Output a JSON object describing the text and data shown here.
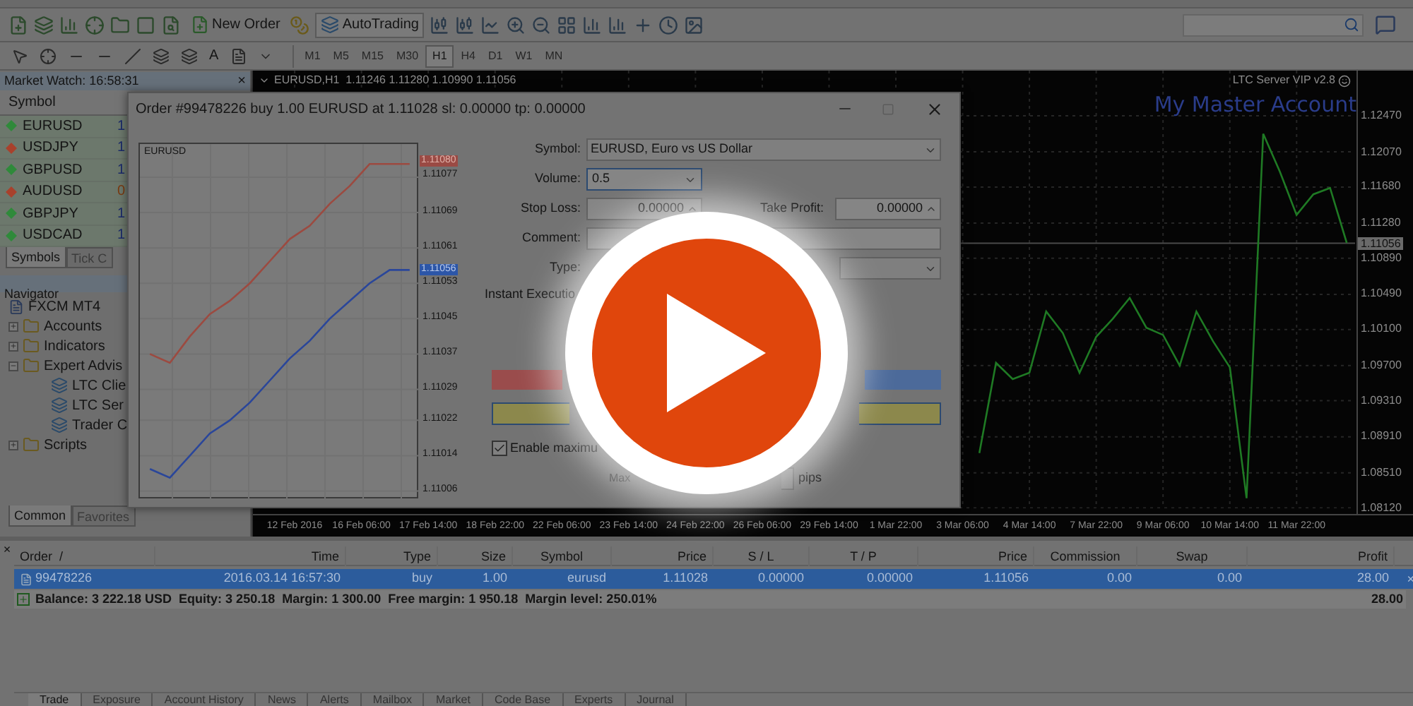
{
  "toolbar": {
    "new_order": "New Order",
    "auto_trading": "AutoTrading",
    "text_tool": "A",
    "timeframes": [
      {
        "label": "M1",
        "selected": false
      },
      {
        "label": "M5",
        "selected": false
      },
      {
        "label": "M15",
        "selected": false
      },
      {
        "label": "M30",
        "selected": false
      },
      {
        "label": "H1",
        "selected": true
      },
      {
        "label": "H4",
        "selected": false
      },
      {
        "label": "D1",
        "selected": false
      },
      {
        "label": "W1",
        "selected": false
      },
      {
        "label": "MN",
        "selected": false
      }
    ]
  },
  "market_watch": {
    "title": "Market Watch: 16:58:31",
    "close": "×",
    "column": "Symbol",
    "rows": [
      {
        "symbol": "EURUSD",
        "bid": "1",
        "color": "#2f8a3a"
      },
      {
        "symbol": "USDJPY",
        "bid": "1",
        "color": "#a8412c"
      },
      {
        "symbol": "GBPUSD",
        "bid": "1",
        "color": "#2f8a3a"
      },
      {
        "symbol": "AUDUSD",
        "bid": "0",
        "color": "#a8412c"
      },
      {
        "symbol": "GBPJPY",
        "bid": "1",
        "color": "#2f8a3a"
      },
      {
        "symbol": "USDCAD",
        "bid": "1",
        "color": "#2f8a3a"
      }
    ],
    "tabs": [
      {
        "label": "Symbols",
        "selected": true
      },
      {
        "label": "Tick C",
        "selected": false
      }
    ]
  },
  "navigator": {
    "title": "Navigator",
    "root": "FXCM MT4",
    "items": [
      {
        "label": "Accounts",
        "expanded": false
      },
      {
        "label": "Indicators",
        "expanded": false
      },
      {
        "label": "Expert Advis",
        "expanded": true,
        "children": [
          {
            "label": "LTC Clie"
          },
          {
            "label": "LTC Ser"
          },
          {
            "label": "Trader C"
          }
        ]
      },
      {
        "label": "Scripts",
        "expanded": false
      }
    ],
    "tabs": [
      {
        "label": "Common",
        "selected": true
      },
      {
        "label": "Favorites",
        "selected": false
      }
    ]
  },
  "chart": {
    "title": "EURUSD,H1  1.11246 1.11280 1.10990 1.11056",
    "server": "LTC Server VIP v2.8",
    "account": "My Master Account",
    "chart_data": {
      "type": "line",
      "categories": [
        null,
        null,
        "12 Feb 2016",
        null,
        null,
        null,
        "16 Feb 06:00",
        null,
        null,
        null,
        "17 Feb 14:00",
        null,
        null,
        null,
        "18 Feb 22:00",
        null,
        null,
        null,
        "22 Feb 06:00",
        null,
        null,
        null,
        "23 Feb 14:00",
        null,
        null,
        null,
        "24 Feb 22:00",
        null,
        null,
        null,
        "26 Feb 06:00",
        null,
        null,
        null,
        "29 Feb 14:00",
        null,
        null,
        null,
        "1 Mar 22:00",
        null,
        null,
        null,
        "3 Mar 06:00",
        null,
        null,
        null,
        "4 Mar 14:00",
        null,
        null,
        null,
        "7 Mar 22:00",
        null,
        null,
        null,
        "9 Mar 06:00",
        null,
        null,
        null,
        "10 Mar 14:00",
        null,
        null,
        null,
        "11 Mar 22:00",
        null,
        null,
        null
      ],
      "grid": true,
      "ref_lines": [
        {
          "axis": "y",
          "value": 1.11056,
          "label": "1.11056"
        }
      ],
      "series": [
        {
          "color": "#1f7a24",
          "values": [
            null,
            null,
            null,
            null,
            null,
            null,
            null,
            null,
            null,
            null,
            null,
            null,
            null,
            null,
            null,
            null,
            null,
            null,
            null,
            null,
            null,
            null,
            null,
            null,
            null,
            null,
            null,
            null,
            null,
            null,
            null,
            null,
            null,
            null,
            null,
            null,
            null,
            null,
            null,
            null,
            null,
            null,
            null,
            1.0873,
            1.0973,
            1.0955,
            1.0962,
            1.103,
            1.1006,
            1.0962,
            1.1002,
            1.1022,
            1.1045,
            1.1012,
            1.1004,
            1.097,
            1.103,
            1.0997,
            1.0968,
            1.0823,
            1.1227,
            1.1185,
            1.1137,
            1.116,
            1.1167,
            1.1106
          ]
        }
      ],
      "ylim": [
        1.08117,
        1.12971
      ],
      "yticks": [
        {
          "value": 1.1247,
          "label": "1.12470"
        },
        {
          "value": 1.1207,
          "label": "1.12070"
        },
        {
          "value": 1.1168,
          "label": "1.11680"
        },
        {
          "value": 1.1128,
          "label": "1.11280"
        },
        {
          "value": 1.1089,
          "label": "1.10890"
        },
        {
          "value": 1.1049,
          "label": "1.10490"
        },
        {
          "value": 1.101,
          "label": "1.10100"
        },
        {
          "value": 1.097,
          "label": "1.09700"
        },
        {
          "value": 1.0931,
          "label": "1.09310"
        },
        {
          "value": 1.0891,
          "label": "1.08910"
        },
        {
          "value": 1.0851,
          "label": "1.08510"
        },
        {
          "value": 1.0812,
          "label": "1.08120"
        }
      ]
    }
  },
  "order_dialog": {
    "title": "Order #99478226 buy 1.00 EURUSD at 1.11028 sl: 0.00000 tp: 0.00000",
    "chart": {
      "symbol": "EURUSD",
      "ask_tag": "1.11080",
      "bid_tag": "1.11056",
      "chart_data": {
        "type": "line",
        "categories": [
          null,
          null,
          null,
          null,
          null,
          null,
          null,
          null,
          null,
          null,
          null,
          null,
          null,
          null
        ],
        "grid": true,
        "ylim": [
          1.11004,
          1.110845
        ],
        "series": [
          {
            "color": "#9c4a40",
            "values": [
              1.11037,
              1.11035,
              1.11041,
              1.11046,
              1.11049,
              1.11053,
              1.11058,
              1.11063,
              1.11066,
              1.11071,
              1.11075,
              1.1108,
              1.1108,
              1.1108
            ]
          },
          {
            "color": "#2a469a",
            "values": [
              1.11011,
              1.11009,
              1.11014,
              1.11019,
              1.11022,
              1.11026,
              1.11031,
              1.11036,
              1.1104,
              1.11045,
              1.11049,
              1.11053,
              1.11056,
              1.11056
            ]
          }
        ],
        "yticks": [
          {
            "value": 1.11077,
            "label": "1.11077"
          },
          {
            "value": 1.11069,
            "label": "1.11069"
          },
          {
            "value": 1.11061,
            "label": "1.11061"
          },
          {
            "value": 1.11053,
            "label": "1.11053"
          },
          {
            "value": 1.11045,
            "label": "1.11045"
          },
          {
            "value": 1.11037,
            "label": "1.11037"
          },
          {
            "value": 1.11029,
            "label": "1.11029"
          },
          {
            "value": 1.11022,
            "label": "1.11022"
          },
          {
            "value": 1.11014,
            "label": "1.11014"
          },
          {
            "value": 1.11006,
            "label": "1.11006"
          }
        ]
      }
    },
    "form": {
      "symbol_label": "Symbol:",
      "symbol": "EURUSD, Euro vs US Dollar",
      "volume_label": "Volume:",
      "volume": "0.5",
      "stop_loss_label": "Stop Loss:",
      "stop_loss": "0.00000",
      "take_profit_label": "Take Profit:",
      "take_profit": "0.00000",
      "comment_label": "Comment:",
      "type_label": "Type:",
      "execution": "Instant Executio",
      "max_deviation_checked": true,
      "max_deviation_label": "Enable maximu",
      "deviation_label": "Max",
      "deviation_unit": "pips"
    }
  },
  "terminal": {
    "close": "×",
    "columns": [
      "Order  /",
      "Time",
      "Type",
      "Size",
      "Symbol",
      "Price",
      "S / L",
      "T / P",
      "Price",
      "Commission",
      "Swap",
      "Profit"
    ],
    "rows": [
      {
        "selected": true,
        "cells": [
          "99478226",
          "2016.03.14 16:57:30",
          "buy",
          "1.00",
          "eurusd",
          "1.11028",
          "0.00000",
          "0.00000",
          "1.11056",
          "0.00",
          "0.00",
          "28.00"
        ],
        "close": "×"
      }
    ],
    "summary": {
      "text": "Balance: 3 222.18 USD  Equity: 3 250.18  Margin: 1 300.00  Free margin: 1 950.18  Margin level: 250.01%",
      "profit": "28.00"
    },
    "tabs": [
      {
        "label": "Trade",
        "selected": true
      },
      {
        "label": "Exposure",
        "selected": false
      },
      {
        "label": "Account History",
        "selected": false
      },
      {
        "label": "News",
        "selected": false
      },
      {
        "label": "Alerts",
        "selected": false
      },
      {
        "label": "Mailbox",
        "selected": false
      },
      {
        "label": "Market",
        "selected": false
      },
      {
        "label": "Code Base",
        "selected": false
      },
      {
        "label": "Experts",
        "selected": false
      },
      {
        "label": "Journal",
        "selected": false
      }
    ]
  }
}
